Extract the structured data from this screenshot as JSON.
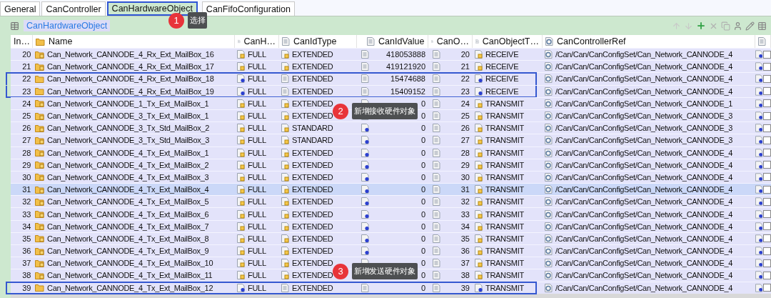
{
  "tabs": [
    {
      "label": "General",
      "selected": false,
      "outlined": false
    },
    {
      "label": "CanController",
      "selected": false,
      "outlined": false
    },
    {
      "label": "CanHardwareObject",
      "selected": true,
      "outlined": true
    },
    {
      "label": "CanFifoConfiguration",
      "selected": false,
      "outlined": false
    }
  ],
  "section": {
    "title": "CanHardwareObject"
  },
  "table": {
    "columns": [
      "In…",
      "Name",
      "CanH…",
      "CanIdType",
      "CanIdValue",
      "CanO…",
      "CanObjectT…",
      "CanControllerRef"
    ],
    "rows": [
      {
        "index": "20",
        "name": "Can_Network_CANNODE_4_Rx_Ext_MailBox_16",
        "can_h": "FULL",
        "id_type": "EXTENDED",
        "id_value": "418053888",
        "can_o": "20",
        "object_type": "RECEIVE",
        "controller_ref": "/Can/Can/CanConfigSet/Can_Network_CANNODE_4",
        "new": false,
        "selected": false,
        "outlined": false
      },
      {
        "index": "21",
        "name": "Can_Network_CANNODE_4_Rx_Ext_MailBox_17",
        "can_h": "FULL",
        "id_type": "EXTENDED",
        "id_value": "419121920",
        "can_o": "21",
        "object_type": "RECEIVE",
        "controller_ref": "/Can/Can/CanConfigSet/Can_Network_CANNODE_4",
        "new": false,
        "selected": false,
        "outlined": false
      },
      {
        "index": "22",
        "name": "Can_Network_CANNODE_4_Rx_Ext_MailBox_18",
        "can_h": "FULL",
        "id_type": "EXTENDED",
        "id_value": "15474688",
        "can_o": "22",
        "object_type": "RECEIVE",
        "controller_ref": "/Can/Can/CanConfigSet/Can_Network_CANNODE_4",
        "new": true,
        "selected": false,
        "outlined": true
      },
      {
        "index": "23",
        "name": "Can_Network_CANNODE_4_Rx_Ext_MailBox_19",
        "can_h": "FULL",
        "id_type": "EXTENDED",
        "id_value": "15409152",
        "can_o": "23",
        "object_type": "RECEIVE",
        "controller_ref": "/Can/Can/CanConfigSet/Can_Network_CANNODE_4",
        "new": true,
        "selected": false,
        "outlined": true
      },
      {
        "index": "24",
        "name": "Can_Network_CANNODE_1_Tx_Ext_MailBox_1",
        "can_h": "FULL",
        "id_type": "EXTENDED",
        "id_value": "0",
        "can_o": "24",
        "object_type": "TRANSMIT",
        "controller_ref": "/Can/Can/CanConfigSet/Can_Network_CANNODE_1",
        "new": false,
        "selected": false,
        "outlined": false
      },
      {
        "index": "25",
        "name": "Can_Network_CANNODE_3_Tx_Ext_MailBox_1",
        "can_h": "FULL",
        "id_type": "EXTENDED",
        "id_value": "0",
        "can_o": "25",
        "object_type": "TRANSMIT",
        "controller_ref": "/Can/Can/CanConfigSet/Can_Network_CANNODE_3",
        "new": false,
        "selected": false,
        "outlined": false
      },
      {
        "index": "26",
        "name": "Can_Network_CANNODE_3_Tx_Std_MailBox_2",
        "can_h": "FULL",
        "id_type": "STANDARD",
        "id_value": "0",
        "can_o": "26",
        "object_type": "TRANSMIT",
        "controller_ref": "/Can/Can/CanConfigSet/Can_Network_CANNODE_3",
        "new": false,
        "selected": false,
        "outlined": false
      },
      {
        "index": "27",
        "name": "Can_Network_CANNODE_3_Tx_Std_MailBox_3",
        "can_h": "FULL",
        "id_type": "STANDARD",
        "id_value": "0",
        "can_o": "27",
        "object_type": "TRANSMIT",
        "controller_ref": "/Can/Can/CanConfigSet/Can_Network_CANNODE_3",
        "new": false,
        "selected": false,
        "outlined": false
      },
      {
        "index": "28",
        "name": "Can_Network_CANNODE_4_Tx_Ext_MailBox_1",
        "can_h": "FULL",
        "id_type": "EXTENDED",
        "id_value": "0",
        "can_o": "28",
        "object_type": "TRANSMIT",
        "controller_ref": "/Can/Can/CanConfigSet/Can_Network_CANNODE_4",
        "new": false,
        "selected": false,
        "outlined": false
      },
      {
        "index": "29",
        "name": "Can_Network_CANNODE_4_Tx_Ext_MailBox_2",
        "can_h": "FULL",
        "id_type": "EXTENDED",
        "id_value": "0",
        "can_o": "29",
        "object_type": "TRANSMIT",
        "controller_ref": "/Can/Can/CanConfigSet/Can_Network_CANNODE_4",
        "new": false,
        "selected": false,
        "outlined": false
      },
      {
        "index": "30",
        "name": "Can_Network_CANNODE_4_Tx_Ext_MailBox_3",
        "can_h": "FULL",
        "id_type": "EXTENDED",
        "id_value": "0",
        "can_o": "30",
        "object_type": "TRANSMIT",
        "controller_ref": "/Can/Can/CanConfigSet/Can_Network_CANNODE_4",
        "new": false,
        "selected": false,
        "outlined": false
      },
      {
        "index": "31",
        "name": "Can_Network_CANNODE_4_Tx_Ext_MailBox_4",
        "can_h": "FULL",
        "id_type": "EXTENDED",
        "id_value": "0",
        "can_o": "31",
        "object_type": "TRANSMIT",
        "controller_ref": "/Can/Can/CanConfigSet/Can_Network_CANNODE_4",
        "new": false,
        "selected": true,
        "outlined": false
      },
      {
        "index": "32",
        "name": "Can_Network_CANNODE_4_Tx_Ext_MailBox_5",
        "can_h": "FULL",
        "id_type": "EXTENDED",
        "id_value": "0",
        "can_o": "32",
        "object_type": "TRANSMIT",
        "controller_ref": "/Can/Can/CanConfigSet/Can_Network_CANNODE_4",
        "new": false,
        "selected": false,
        "outlined": false
      },
      {
        "index": "33",
        "name": "Can_Network_CANNODE_4_Tx_Ext_MailBox_6",
        "can_h": "FULL",
        "id_type": "EXTENDED",
        "id_value": "0",
        "can_o": "33",
        "object_type": "TRANSMIT",
        "controller_ref": "/Can/Can/CanConfigSet/Can_Network_CANNODE_4",
        "new": false,
        "selected": false,
        "outlined": false
      },
      {
        "index": "34",
        "name": "Can_Network_CANNODE_4_Tx_Ext_MailBox_7",
        "can_h": "FULL",
        "id_type": "EXTENDED",
        "id_value": "0",
        "can_o": "34",
        "object_type": "TRANSMIT",
        "controller_ref": "/Can/Can/CanConfigSet/Can_Network_CANNODE_4",
        "new": false,
        "selected": false,
        "outlined": false
      },
      {
        "index": "35",
        "name": "Can_Network_CANNODE_4_Tx_Ext_MailBox_8",
        "can_h": "FULL",
        "id_type": "EXTENDED",
        "id_value": "0",
        "can_o": "35",
        "object_type": "TRANSMIT",
        "controller_ref": "/Can/Can/CanConfigSet/Can_Network_CANNODE_4",
        "new": false,
        "selected": false,
        "outlined": false
      },
      {
        "index": "36",
        "name": "Can_Network_CANNODE_4_Tx_Ext_MailBox_9",
        "can_h": "FULL",
        "id_type": "EXTENDED",
        "id_value": "0",
        "can_o": "36",
        "object_type": "TRANSMIT",
        "controller_ref": "/Can/Can/CanConfigSet/Can_Network_CANNODE_4",
        "new": false,
        "selected": false,
        "outlined": false
      },
      {
        "index": "37",
        "name": "Can_Network_CANNODE_4_Tx_Ext_MailBox_10",
        "can_h": "FULL",
        "id_type": "EXTENDED",
        "id_value": "0",
        "can_o": "37",
        "object_type": "TRANSMIT",
        "controller_ref": "/Can/Can/CanConfigSet/Can_Network_CANNODE_4",
        "new": false,
        "selected": false,
        "outlined": false
      },
      {
        "index": "38",
        "name": "Can_Network_CANNODE_4_Tx_Ext_MailBox_11",
        "can_h": "FULL",
        "id_type": "EXTENDED",
        "id_value": "0",
        "can_o": "38",
        "object_type": "TRANSMIT",
        "controller_ref": "/Can/Can/CanConfigSet/Can_Network_CANNODE_4",
        "new": false,
        "selected": false,
        "outlined": false
      },
      {
        "index": "39",
        "name": "Can_Network_CANNODE_4_Tx_Ext_MailBox_12",
        "can_h": "FULL",
        "id_type": "EXTENDED",
        "id_value": "0",
        "can_o": "39",
        "object_type": "TRANSMIT",
        "controller_ref": "/Can/Can/CanConfigSet/Can_Network_CANNODE_4",
        "new": true,
        "selected": false,
        "outlined": true
      }
    ]
  },
  "callouts": [
    {
      "number": "1",
      "text": "选择"
    },
    {
      "number": "2",
      "text": "新增接收硬件对象"
    },
    {
      "number": "3",
      "text": "新增发送硬件对象"
    }
  ]
}
